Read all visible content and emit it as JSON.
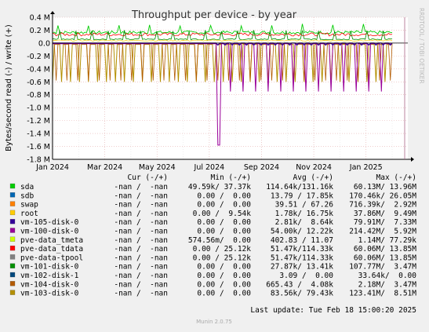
{
  "chart_data": {
    "type": "line",
    "title": "Throughput per device - by year",
    "ylabel": "Bytes/second read (-) / write (+)",
    "watermark": "RRDTOOL / TOBI OETIKER",
    "y_ticks": [
      "0.4 M",
      "0.2 M",
      "0.0",
      "-0.2 M",
      "-0.4 M",
      "-0.6 M",
      "-0.8 M",
      "-1.0 M",
      "-1.2 M",
      "-1.4 M",
      "-1.6 M",
      "-1.8 M"
    ],
    "y_tick_values": [
      0.4,
      0.2,
      0.0,
      -0.2,
      -0.4,
      -0.6,
      -0.8,
      -1.0,
      -1.2,
      -1.4,
      -1.6,
      -1.8
    ],
    "ylim": [
      -1.8,
      0.4
    ],
    "x_ticks": [
      "Jan 2024",
      "Mar 2024",
      "May 2024",
      "Jul 2024",
      "Sep 2024",
      "Nov 2024",
      "Jan 2025"
    ],
    "x_tick_months": [
      0,
      2,
      4,
      6,
      8,
      10,
      12
    ],
    "xlim_months": [
      0,
      13.6
    ],
    "grid": true,
    "legend_header": {
      "cur": "Cur (-/+)",
      "min": "Min (-/+)",
      "avg": "Avg (-/+)",
      "max": "Max (-/+)"
    },
    "series": [
      {
        "name": "sda",
        "color": "#00cc00",
        "cur": "-nan /  -nan",
        "min": "49.59k/ 37.37k",
        "avg": "114.64k/131.16k",
        "max": "60.13M/ 13.96M"
      },
      {
        "name": "sdb",
        "color": "#0066b3",
        "cur": "-nan /  -nan",
        "min": "0.00 /  0.00",
        "avg": "13.79 / 17.85k",
        "max": "170.46k/ 26.05M"
      },
      {
        "name": "swap",
        "color": "#ff8000",
        "cur": "-nan /  -nan",
        "min": "0.00 /  0.00",
        "avg": "39.51 / 67.26",
        "max": "716.39k/  2.92M"
      },
      {
        "name": "root",
        "color": "#ffcc00",
        "cur": "-nan /  -nan",
        "min": "0.00 /  9.54k",
        "avg": "1.78k/ 16.75k",
        "max": "37.86M/  9.49M"
      },
      {
        "name": "vm-105-disk-0",
        "color": "#330099",
        "cur": "-nan /  -nan",
        "min": "0.00 /  0.00",
        "avg": "2.81k/  8.64k",
        "max": "79.91M/  7.33M"
      },
      {
        "name": "vm-100-disk-0",
        "color": "#990099",
        "cur": "-nan /  -nan",
        "min": "0.00 /  0.00",
        "avg": "54.00k/ 12.22k",
        "max": "214.42M/  5.92M"
      },
      {
        "name": "pve-data_tmeta",
        "color": "#ccff00",
        "cur": "-nan /  -nan",
        "min": "574.56m/  0.00",
        "avg": "402.83 / 11.07",
        "max": "1.14M/ 77.29k"
      },
      {
        "name": "pve-data_tdata",
        "color": "#ff0000",
        "cur": "-nan /  -nan",
        "min": "0.00 / 25.12k",
        "avg": "51.47k/114.33k",
        "max": "60.06M/ 13.85M"
      },
      {
        "name": "pve-data-tpool",
        "color": "#808080",
        "cur": "-nan /  -nan",
        "min": "0.00 / 25.12k",
        "avg": "51.47k/114.33k",
        "max": "60.06M/ 13.85M"
      },
      {
        "name": "vm-101-disk-0",
        "color": "#008f00",
        "cur": "-nan /  -nan",
        "min": "0.00 /  0.00",
        "avg": "27.87k/ 13.41k",
        "max": "107.77M/  3.47M"
      },
      {
        "name": "vm-102-disk-1",
        "color": "#00487d",
        "cur": "-nan /  -nan",
        "min": "0.00 /  0.00",
        "avg": "3.09 /  0.00",
        "max": "33.64k/  0.00"
      },
      {
        "name": "vm-104-disk-0",
        "color": "#b35a00",
        "cur": "-nan /  -nan",
        "min": "0.00 /  0.00",
        "avg": "665.43 /  4.08k",
        "max": "2.18M/  3.47M"
      },
      {
        "name": "vm-103-disk-0",
        "color": "#b38f00",
        "cur": "-nan /  -nan",
        "min": "0.00 /  0.00",
        "avg": "83.56k/ 79.43k",
        "max": "123.41M/  8.51M"
      }
    ]
  },
  "footer": {
    "last_update": "Last update: Tue Feb 18 15:00:20 2025",
    "munin_version": "Munin 2.0.75"
  }
}
